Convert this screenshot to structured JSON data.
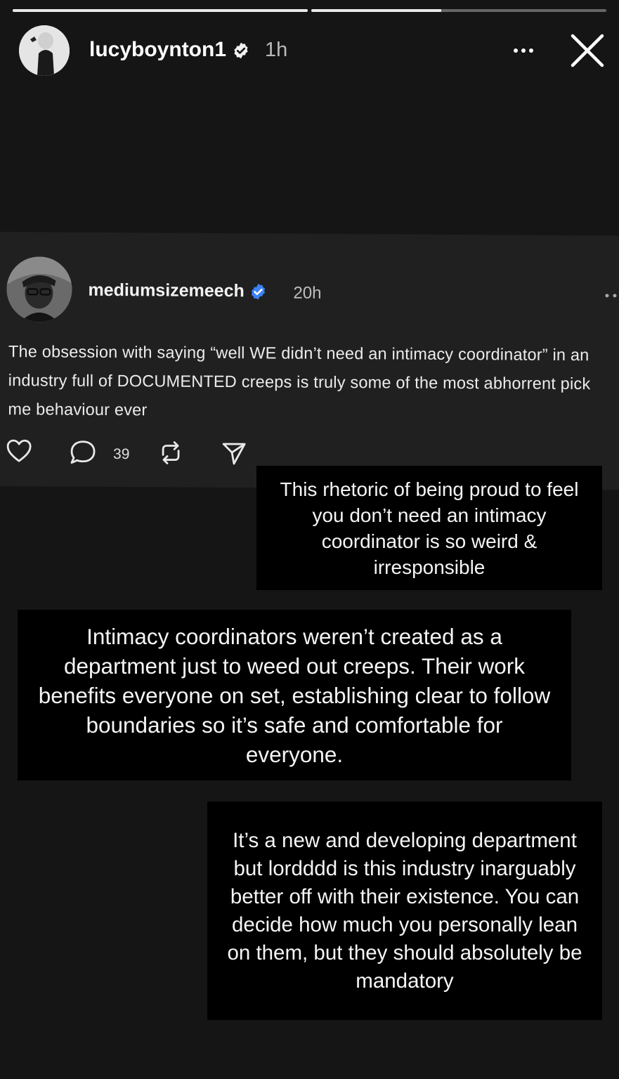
{
  "story": {
    "progress": [
      1.0,
      0.44
    ],
    "username": "lucyboynton1",
    "time": "1h",
    "menu_icon": "more-horizontal-icon",
    "close_icon": "close-icon"
  },
  "post": {
    "username": "mediumsizemeech",
    "time": "20h",
    "text": "The obsession with saying “well WE didn’t need an intimacy coordinator” in an industry full of DOCUMENTED creeps is truly some of the most abhorrent pick me behaviour ever",
    "reply_count": "39",
    "verified_color": "#3b82f6"
  },
  "captions": [
    "This rhetoric of being proud to feel you don’t need an intimacy coordinator is so weird & irresponsible",
    "Intimacy coordinators weren’t created as a department just to weed out creeps. Their work benefits everyone on set, establishing clear to follow boundaries so it’s safe and comfortable for everyone.",
    "It’s a new and developing department but lordddd is this industry inarguably better off with their existence. You can decide how much you personally lean on them, but they should absolutely be mandatory"
  ]
}
